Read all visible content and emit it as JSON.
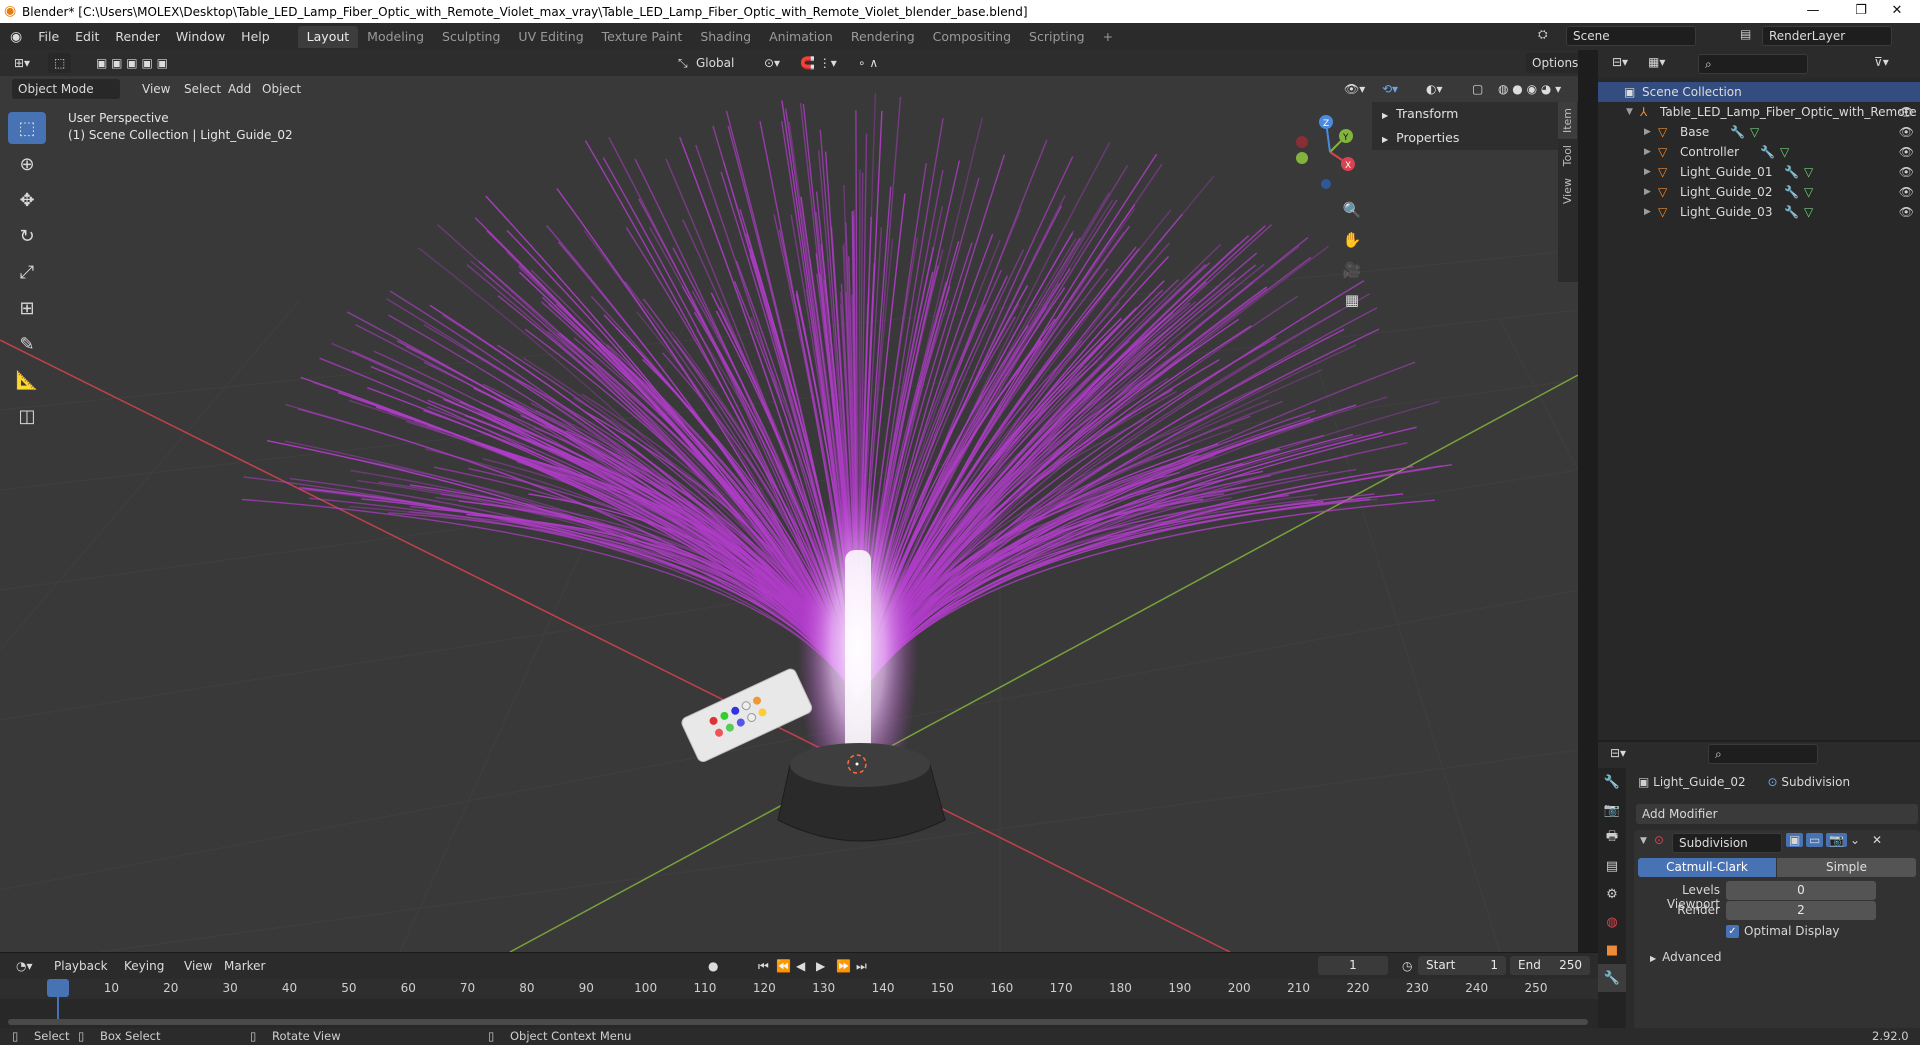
{
  "titlebar": {
    "title": "Blender* [C:\\Users\\MOLEX\\Desktop\\Table_LED_Lamp_Fiber_Optic_with_Remote_Violet_max_vray\\Table_LED_Lamp_Fiber_Optic_with_Remote_Violet_blender_base.blend]",
    "minimize": "—",
    "maximize": "❐",
    "close": "✕"
  },
  "menubar": {
    "items": [
      "File",
      "Edit",
      "Render",
      "Window",
      "Help"
    ],
    "workspaces": [
      "Layout",
      "Modeling",
      "Sculpting",
      "UV Editing",
      "Texture Paint",
      "Shading",
      "Animation",
      "Rendering",
      "Compositing",
      "Scripting"
    ],
    "active_workspace": "Layout",
    "add_tab": "+",
    "scene_label": "Scene",
    "renderlayer_label": "RenderLayer"
  },
  "viewport": {
    "mode": "Object Mode",
    "menus": [
      "View",
      "Select",
      "Add",
      "Object"
    ],
    "transform_orientation": "Global",
    "options": "Options",
    "perspective": "User Perspective",
    "collection_info": "(1) Scene Collection | Light_Guide_02",
    "side_tabs": [
      "Item",
      "Tool",
      "View"
    ],
    "npanel": [
      "Transform",
      "Properties"
    ],
    "gizmo": {
      "x": "X",
      "y": "Y",
      "z": "Z"
    }
  },
  "outliner": {
    "root": "Scene Collection",
    "object": "Table_LED_Lamp_Fiber_Optic_with_Remote",
    "children": [
      "Base",
      "Controller",
      "Light_Guide_01",
      "Light_Guide_02",
      "Light_Guide_03"
    ]
  },
  "properties": {
    "object_name": "Light_Guide_02",
    "modifier_context": "Subdivision",
    "add_modifier": "Add Modifier",
    "modifier_name": "Subdivision",
    "mode_catmull": "Catmull-Clark",
    "mode_simple": "Simple",
    "levels_viewport_label": "Levels Viewport",
    "levels_viewport_value": "0",
    "render_label": "Render",
    "render_value": "2",
    "optimal_display": "Optimal Display",
    "advanced": "Advanced"
  },
  "timeline": {
    "menus": [
      "Playback",
      "Keying",
      "View",
      "Marker"
    ],
    "current_frame": "1",
    "start_label": "Start",
    "start_value": "1",
    "end_label": "End",
    "end_value": "250",
    "ruler": [
      "1",
      "10",
      "20",
      "30",
      "40",
      "50",
      "60",
      "70",
      "80",
      "90",
      "100",
      "110",
      "120",
      "130",
      "140",
      "150",
      "160",
      "170",
      "180",
      "190",
      "200",
      "210",
      "220",
      "230",
      "240",
      "250"
    ]
  },
  "statusbar": {
    "select": "Select",
    "box_select": "Box Select",
    "rotate_view": "Rotate View",
    "context_menu": "Object Context Menu",
    "version": "2.92.0"
  },
  "colors": {
    "accent": "#4772b3",
    "fiber": "#c43ee0",
    "x_axis": "#d9434f",
    "y_axis": "#83b33c",
    "z_axis": "#4a8be0",
    "object_icon": "#ee8b39"
  }
}
